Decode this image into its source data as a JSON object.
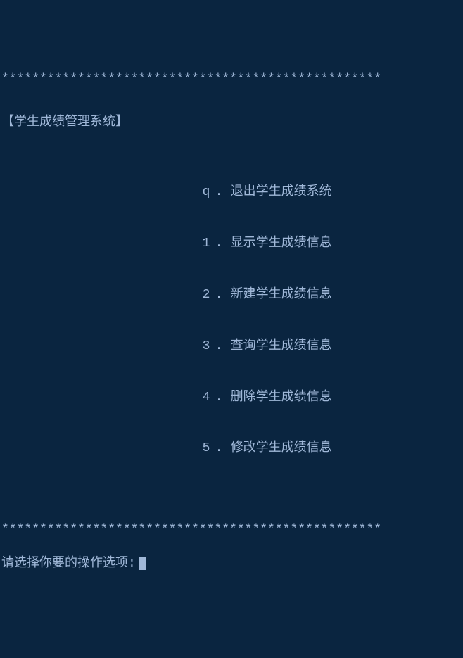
{
  "border": "**************************************************",
  "title": "【学生成绩管理系统】",
  "menu": {
    "items": [
      {
        "key": "q",
        "label": "退出学生成绩系统"
      },
      {
        "key": "1",
        "label": "显示学生成绩信息"
      },
      {
        "key": "2",
        "label": "新建学生成绩信息"
      },
      {
        "key": "3",
        "label": "查询学生成绩信息"
      },
      {
        "key": "4",
        "label": "删除学生成绩信息"
      },
      {
        "key": "5",
        "label": "修改学生成绩信息"
      }
    ]
  },
  "dot": ".",
  "prompt": "请选择你要的操作选项:"
}
